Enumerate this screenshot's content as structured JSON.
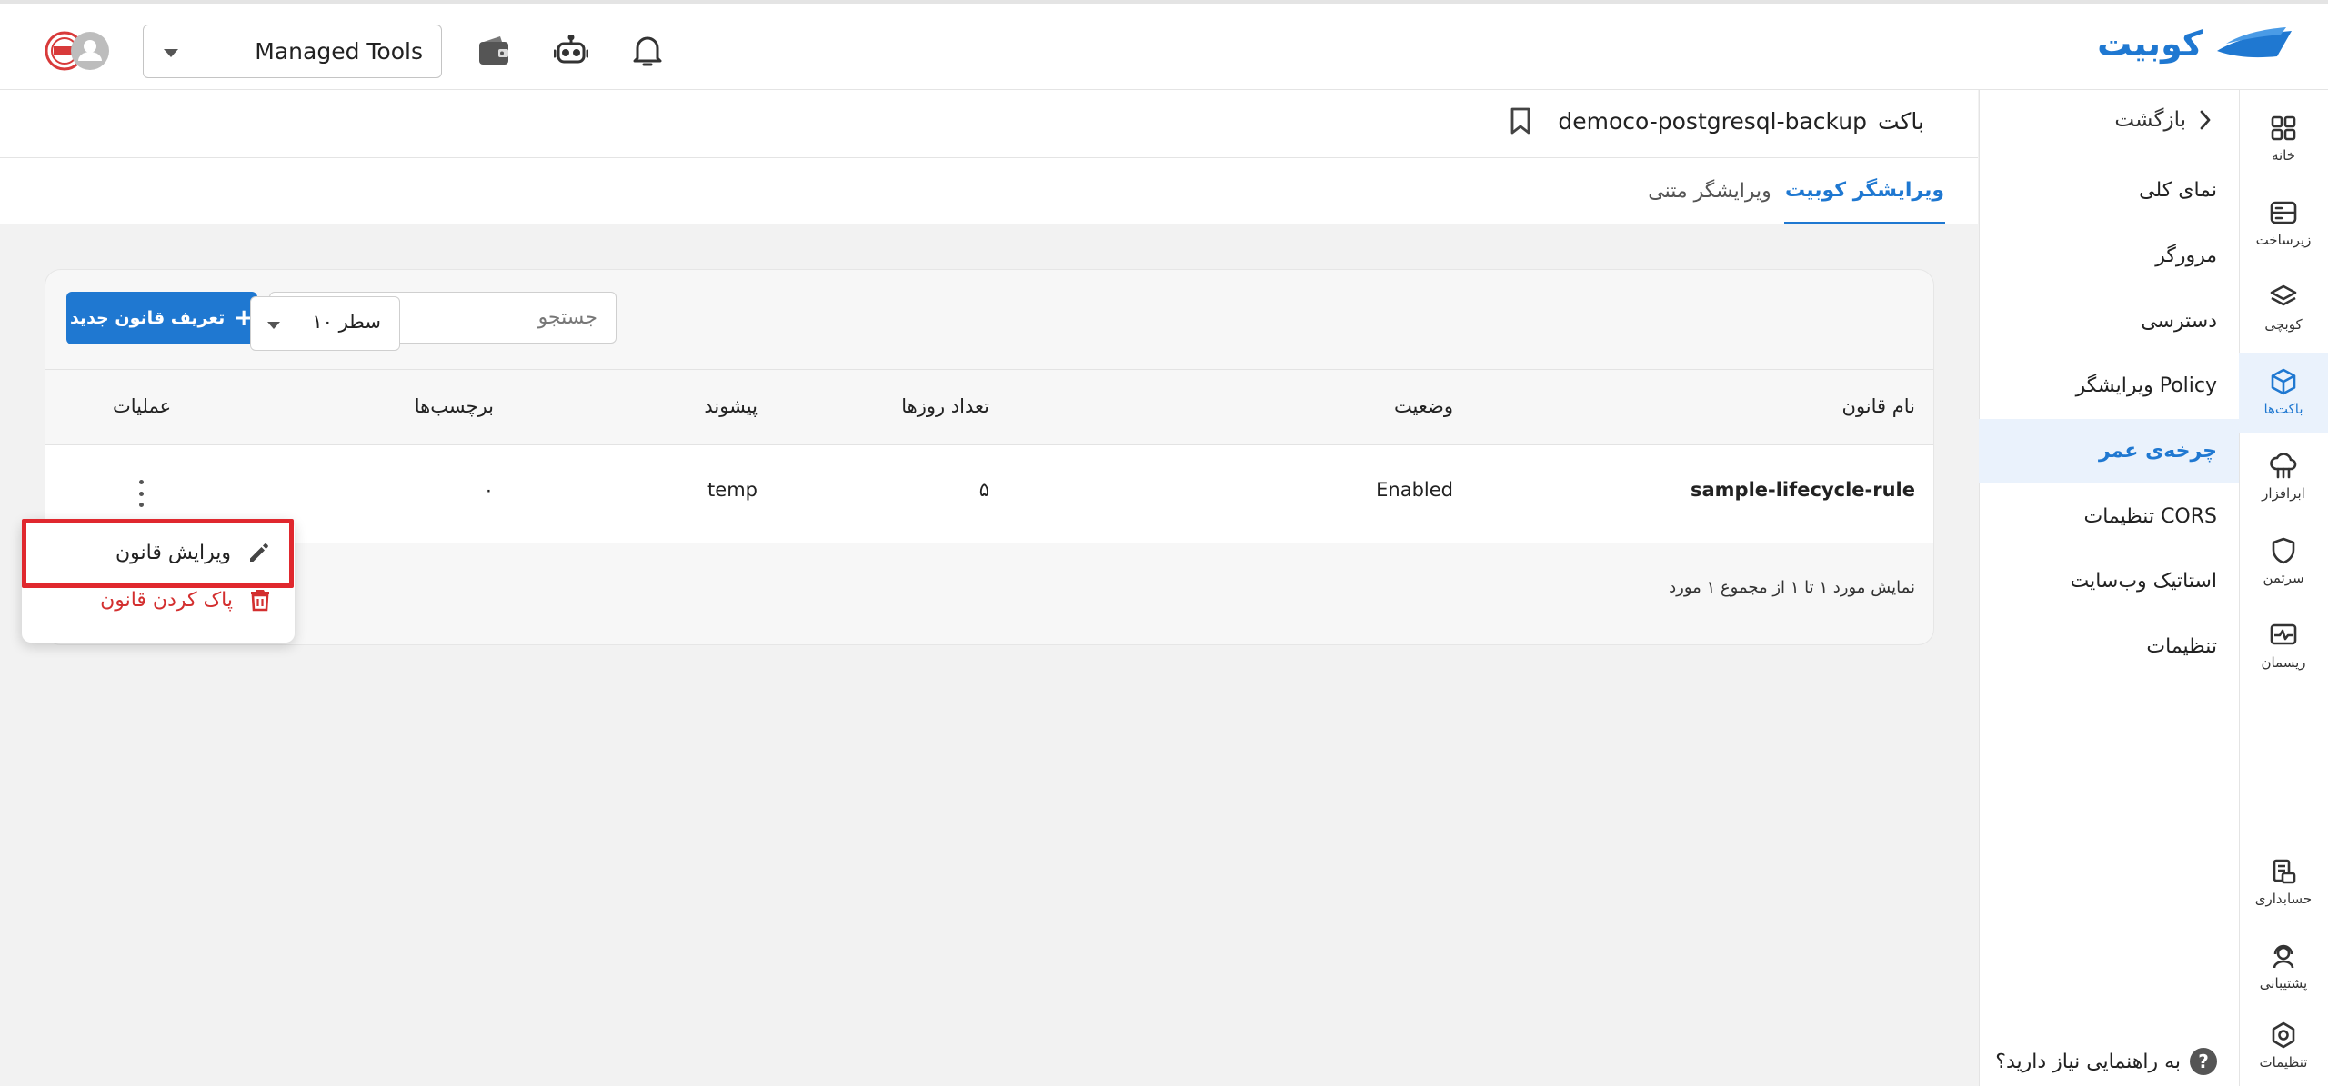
{
  "topbar": {
    "logo_text": "کوبیت",
    "project_select": "Managed Tools",
    "icons": [
      "notification-icon",
      "robot-icon",
      "wallet-icon",
      "avatar"
    ]
  },
  "rail": {
    "items": [
      {
        "label": "خانه",
        "icon": "grid-icon"
      },
      {
        "label": "زیرساخت",
        "icon": "server-icon"
      },
      {
        "label": "کوبچی",
        "icon": "layers-icon"
      },
      {
        "label": "باکت‌ها",
        "icon": "cube-icon",
        "active": true
      },
      {
        "label": "ابرافزار",
        "icon": "cloud-app-icon"
      },
      {
        "label": "سرتمن",
        "icon": "shield-icon"
      },
      {
        "label": "ریسمان",
        "icon": "monitor-icon"
      },
      {
        "label": "حسابداری",
        "icon": "accounting-icon"
      },
      {
        "label": "پشتیبانی",
        "icon": "support-icon"
      },
      {
        "label": "تنظیمات",
        "icon": "settings-icon"
      }
    ]
  },
  "subnav": {
    "back": "بازگشت",
    "items": [
      {
        "label": "نمای کلی"
      },
      {
        "label": "مرورگر"
      },
      {
        "label": "دسترسی"
      },
      {
        "label": "ویرایشگر Policy"
      },
      {
        "label": "چرخه‌ی عمر",
        "active": true
      },
      {
        "label": "تنظیمات CORS"
      },
      {
        "label": "استاتیک وب‌سایت"
      },
      {
        "label": "تنظیمات"
      }
    ],
    "help": "به راهنمایی نیاز دارید؟"
  },
  "header": {
    "prefix": "باکت",
    "bucket_name": "democo-postgresql-backup"
  },
  "tabs": [
    {
      "label": "ویرایشگر کوبیت",
      "active": true
    },
    {
      "label": "ویرایشگر متنی",
      "active": false
    }
  ],
  "toolbar": {
    "search_placeholder": "جستجو",
    "new_rule_label": "تعریف قانون جدید"
  },
  "table": {
    "columns": [
      "نام قانون",
      "وضعیت",
      "تعداد روزها",
      "پیشوند",
      "برچسب‌ها",
      "عملیات"
    ],
    "rows": [
      {
        "name": "sample-lifecycle-rule",
        "status": "Enabled",
        "days": "۵",
        "prefix": "temp",
        "tags": "۰"
      }
    ]
  },
  "pagination": {
    "info": "نمایش مورد ۱ تا ۱ از مجموع ۱ مورد",
    "rows_per_page": "۱۰ سطر"
  },
  "context_menu": {
    "edit": "ویرایش قانون",
    "delete": "پاک کردن قانون"
  },
  "colors": {
    "accent": "#1f78d1",
    "danger": "#d32f2f",
    "highlight": "#e0282e"
  }
}
